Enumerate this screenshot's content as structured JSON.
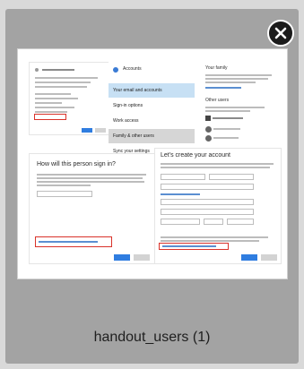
{
  "tile": {
    "filename": "handout_users (1)"
  },
  "thumbnail": {
    "settings_header": "Accounts",
    "settings_items": [
      "Your email and accounts",
      "Sign-in options",
      "Work access",
      "Family & other users",
      "Sync your settings"
    ],
    "signin_question": "How will this person sign in?",
    "create_account_title": "Let's create your account",
    "right_heading_1": "Your family",
    "right_heading_2": "Other users"
  },
  "icons": {
    "close": "close-icon"
  },
  "colors": {
    "tile_background": "#a3a3a3",
    "close_button": "#1b1b1b",
    "accent_blue": "#2f7de0",
    "highlight_red": "#d9322a"
  }
}
